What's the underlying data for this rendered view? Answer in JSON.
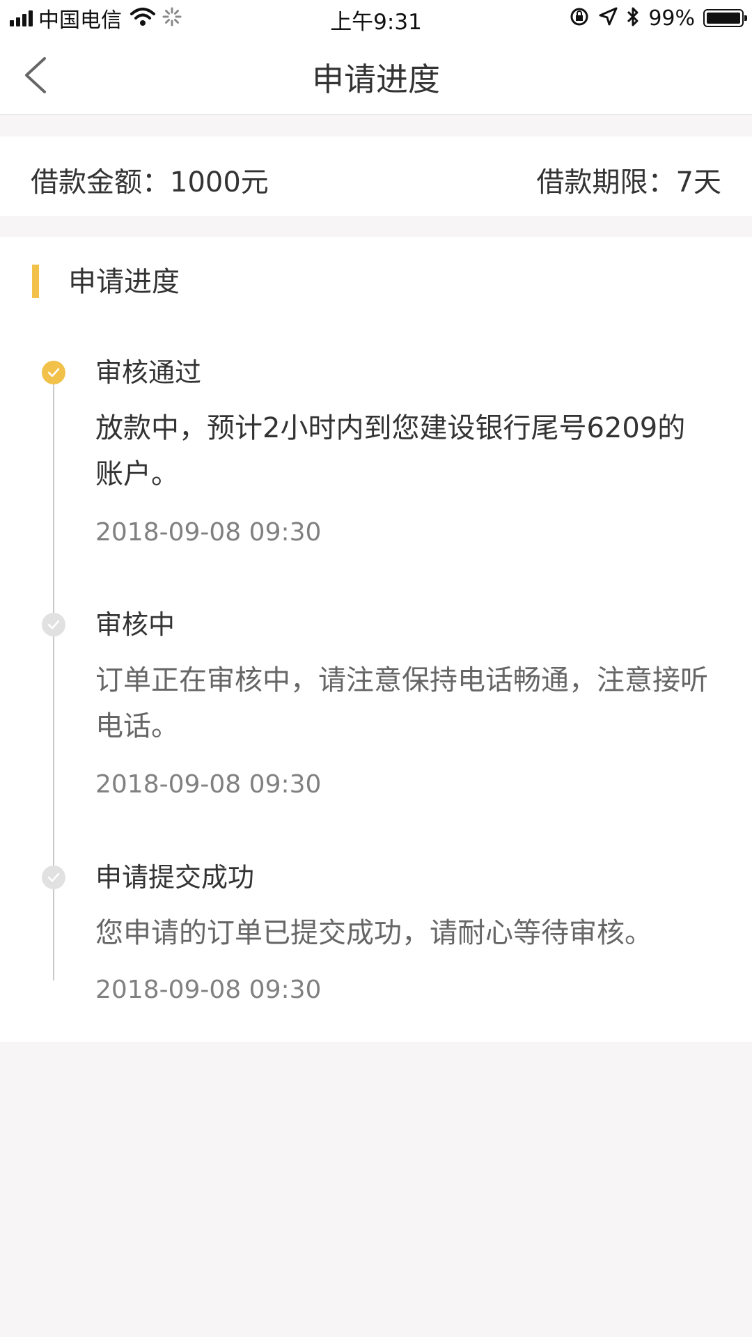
{
  "status_bar": {
    "carrier": "中国电信",
    "time": "上午9:31",
    "battery": "99%",
    "battery_level": 0.99,
    "icons": [
      "signal-icon",
      "wifi-icon",
      "loading-icon",
      "orientation-lock-icon",
      "location-icon",
      "bluetooth-icon",
      "battery-icon"
    ]
  },
  "nav": {
    "title": "申请进度",
    "back_icon": "chevron-left-icon"
  },
  "loan": {
    "amount": "借款金额：1000元",
    "term": "借款期限：7天"
  },
  "progress": {
    "section_title": "申请进度",
    "accent_color": "#f2c14a",
    "steps": [
      {
        "title": "审核通过",
        "desc": "放款中，预计2小时内到您建设银行尾号6209的账户。",
        "time": "2018-09-08 09:30",
        "status": "done"
      },
      {
        "title": "审核中",
        "desc": "订单正在审核中，请注意保持电话畅通，注意接听电话。",
        "time": "2018-09-08 09:30",
        "status": "pending"
      },
      {
        "title": "申请提交成功",
        "desc": "您申请的订单已提交成功，请耐心等待审核。",
        "time": "2018-09-08 09:30",
        "status": "pending"
      }
    ]
  }
}
